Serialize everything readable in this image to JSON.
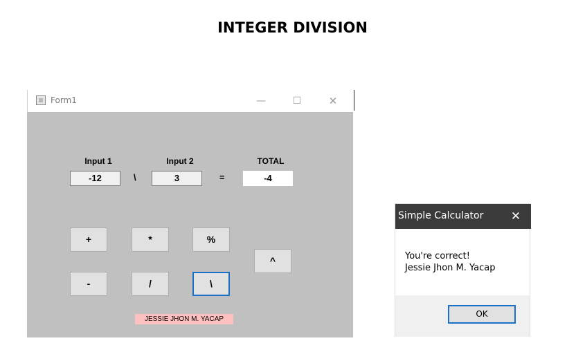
{
  "page": {
    "heading": "INTEGER DIVISION"
  },
  "form": {
    "title": "Form1",
    "controls": {
      "minimize": "—",
      "maximize": "☐",
      "close": "✕"
    },
    "labels": {
      "input1": "Input 1",
      "input2": "Input 2",
      "total": "TOTAL"
    },
    "values": {
      "input1": "-12",
      "input2": "3",
      "total": "-4"
    },
    "operator": "\\",
    "equals": "=",
    "buttons": {
      "add": "+",
      "multiply": "*",
      "modulus": "%",
      "subtract": "-",
      "divide": "/",
      "integer_divide": "\\",
      "power": "^"
    },
    "author_label": "JESSIE JHON M. YACAP"
  },
  "message_box": {
    "title": "Simple Calculator",
    "close": "✕",
    "line1": "You're correct!",
    "line2": "Jessie Jhon M. Yacap",
    "ok": "OK"
  },
  "icons": [
    "app-icon",
    "close-icon"
  ],
  "colors": {
    "form_background": "#c0c0c0",
    "name_label_background": "#ffc0c0",
    "focus_border": "#1a6fc7",
    "message_title_bar": "#3b3b3b"
  }
}
